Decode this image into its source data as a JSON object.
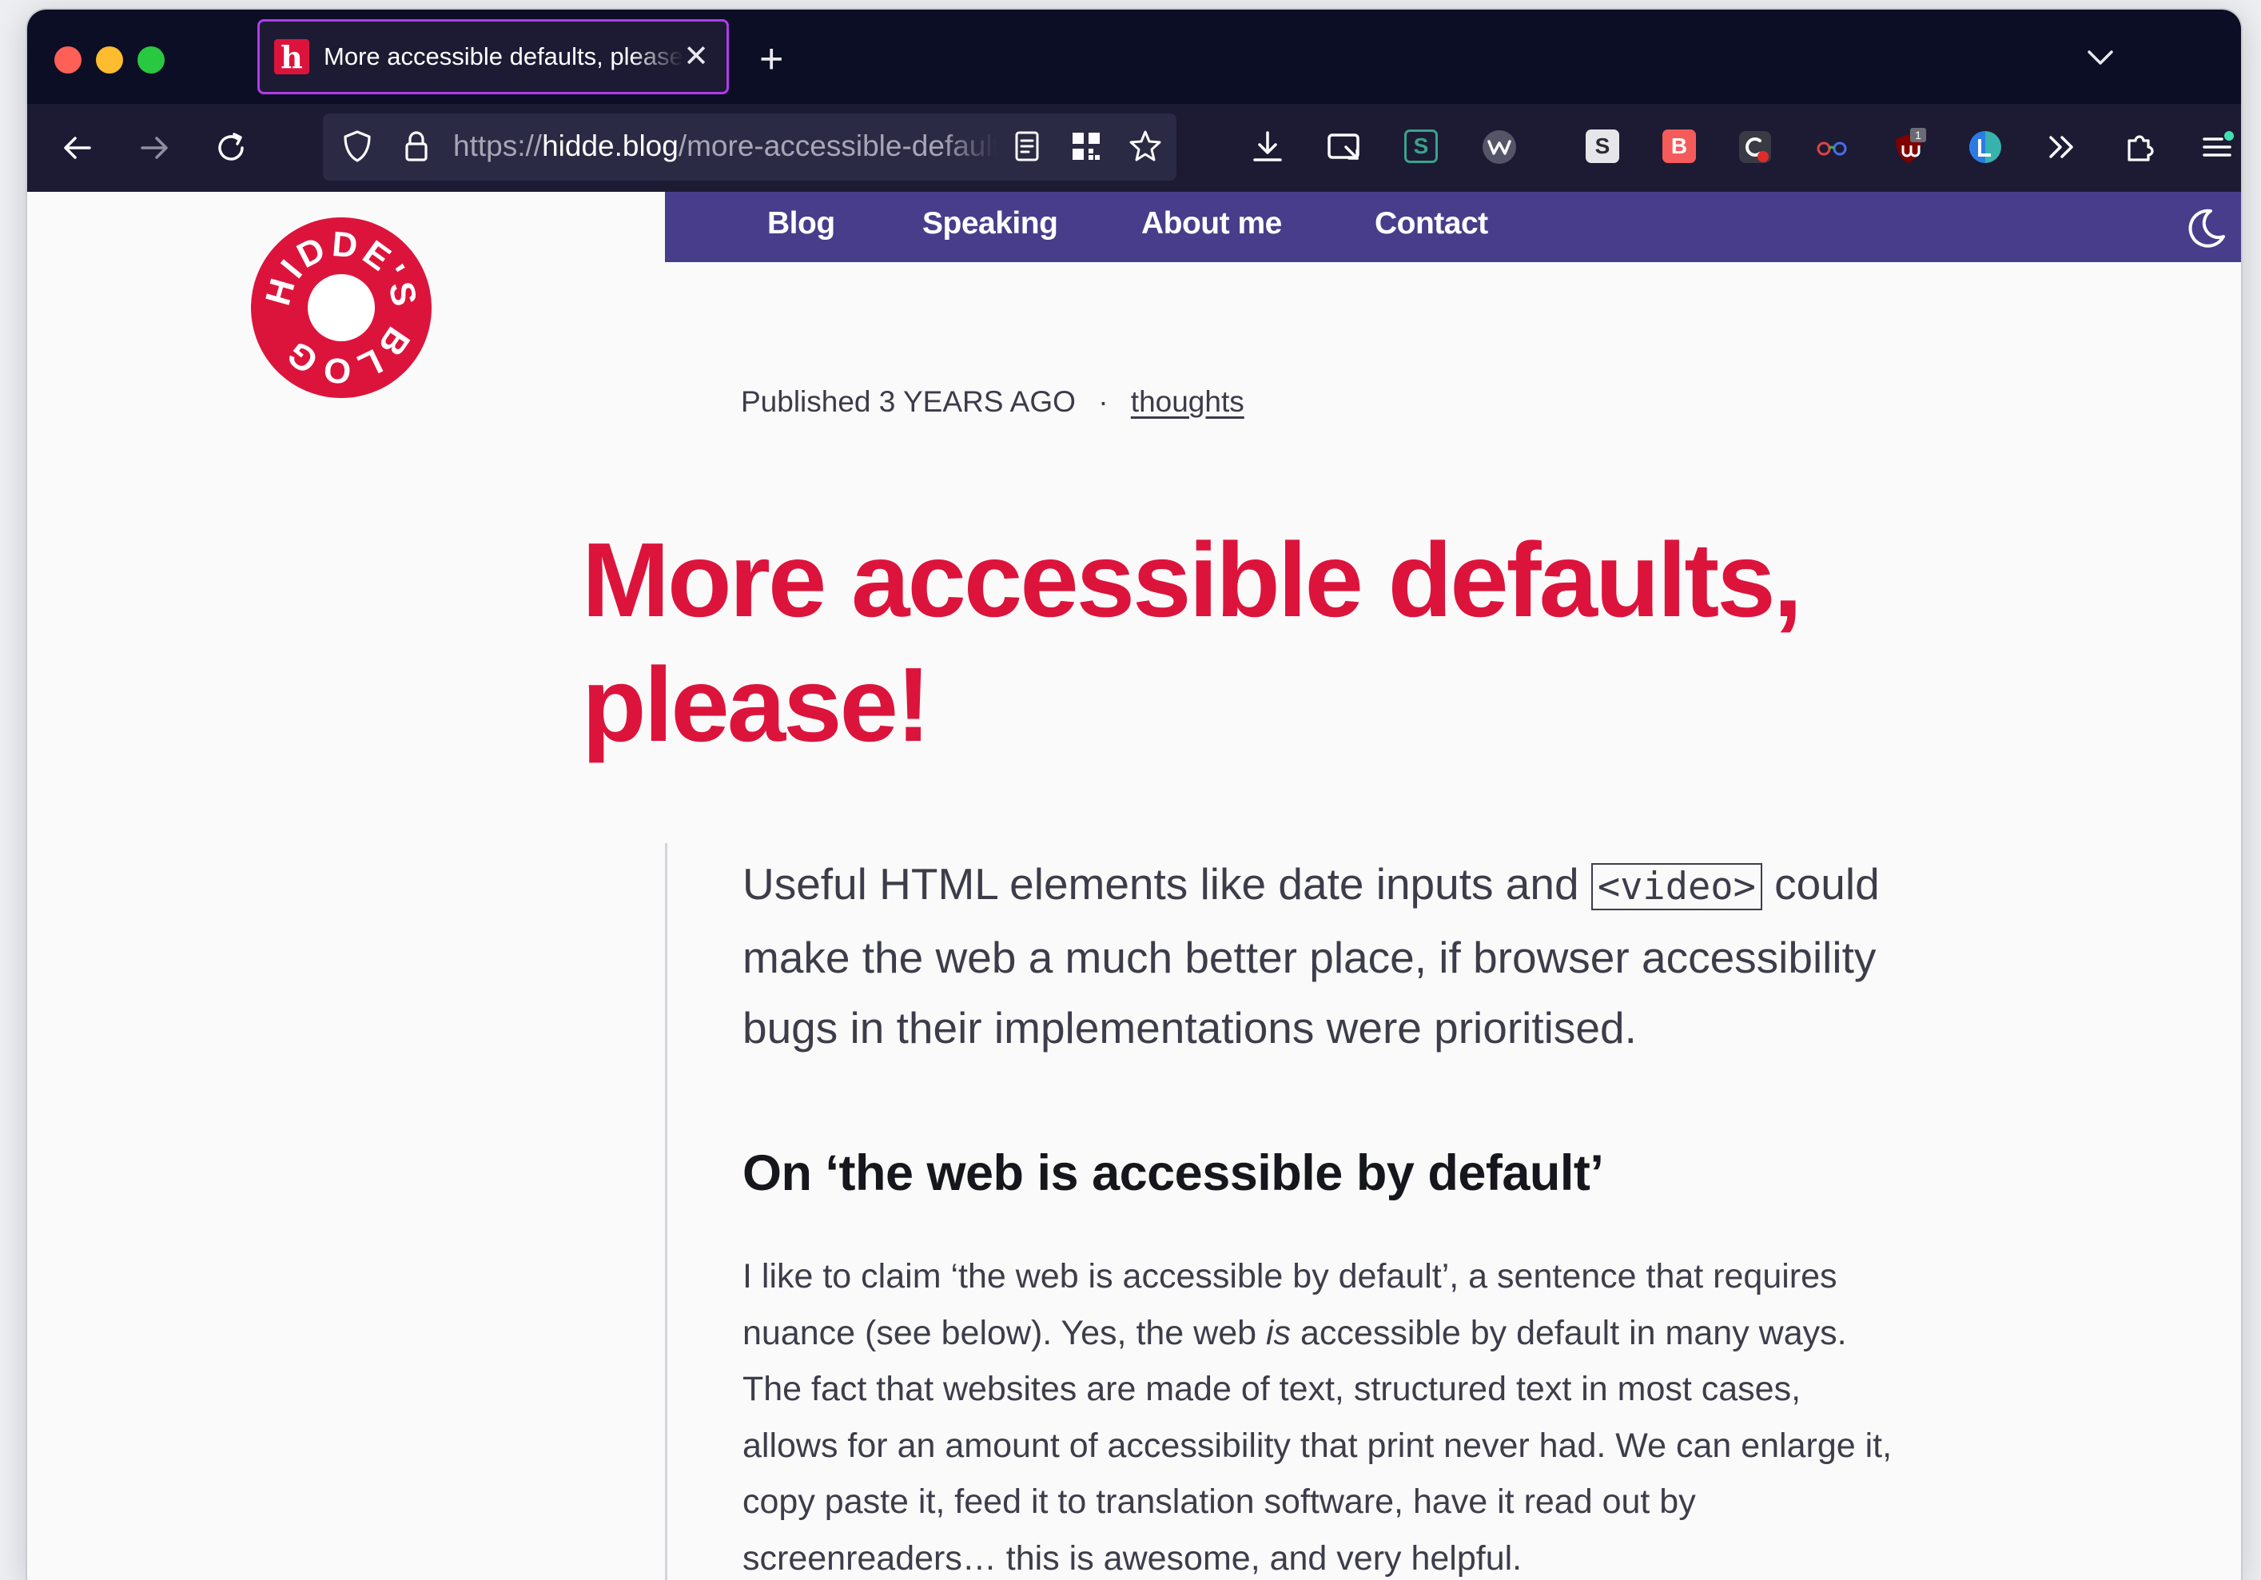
{
  "browser": {
    "tab": {
      "favicon_letter": "h",
      "title": "More accessible defaults, please!",
      "close_glyph": "✕"
    },
    "new_tab_glyph": "+",
    "url": {
      "scheme": "https://",
      "host": "hidde.blog",
      "path": "/more-accessible-defaults/"
    },
    "extensions": [
      {
        "name": "download-icon"
      },
      {
        "name": "screenshot-icon"
      },
      {
        "name": "stylus-s-icon",
        "label": "S"
      },
      {
        "name": "w-extension-icon",
        "label": "W"
      },
      {
        "name": "s-extension-icon",
        "label": "S"
      },
      {
        "name": "b-extension-icon",
        "label": "B"
      },
      {
        "name": "c-extension-icon",
        "label": "C"
      },
      {
        "name": "glasses-icon"
      },
      {
        "name": "ublock-icon",
        "badge": "1"
      },
      {
        "name": "globe-extension-icon"
      },
      {
        "name": "overflow-chevrons-icon"
      },
      {
        "name": "extensions-puzzle-icon"
      },
      {
        "name": "app-menu-icon"
      }
    ],
    "colors": {
      "tab_strip": "#0b0e24",
      "toolbar": "#1c1b33",
      "active_tab_border": "#b13be8"
    }
  },
  "site": {
    "nav": [
      {
        "label": "Blog"
      },
      {
        "label": "Speaking"
      },
      {
        "label": "About me"
      },
      {
        "label": "Contact"
      }
    ],
    "logo_text": "HIDDE'S BLOG",
    "colors": {
      "accent": "#dc143c",
      "nav_bg": "#483d8b"
    }
  },
  "article": {
    "meta": {
      "published_label": "Published",
      "age": "3 YEARS AGO",
      "separator": "·",
      "tag": "thoughts"
    },
    "title": "More accessible defaults, please!",
    "lead": {
      "before": "Useful HTML elements like date inputs and ",
      "code": "<video>",
      "after": " could make the web a much better place, if browser accessibility bugs in their implementations were prioritised."
    },
    "heading": "On ‘the web is accessible by default’",
    "paragraph": {
      "before": "I like to claim ‘the web is accessible by default’, a sentence that requires nuance (see below). Yes, the web ",
      "em": "is",
      "after": " accessible by default in many ways. The fact that websites are made of text, structured text in most cases, allows for an amount of accessibility that print never had. We can enlarge it, copy paste it, feed it to translation software, have it read out by screenreaders… this is awesome, and very helpful."
    }
  }
}
